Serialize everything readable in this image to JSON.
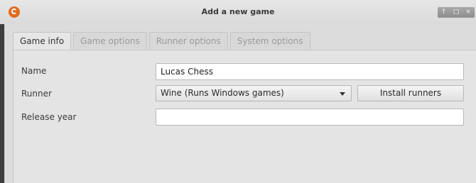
{
  "window": {
    "title": "Add a new game",
    "controls": [
      "↑",
      "□",
      "×"
    ]
  },
  "tabs": [
    {
      "label": "Game info",
      "active": true
    },
    {
      "label": "Game options",
      "active": false
    },
    {
      "label": "Runner options",
      "active": false
    },
    {
      "label": "System options",
      "active": false
    }
  ],
  "form": {
    "name_label": "Name",
    "name_value": "Lucas Chess",
    "runner_label": "Runner",
    "runner_value": "Wine (Runs Windows games)",
    "install_runners_label": "Install runners",
    "release_year_label": "Release year",
    "release_year_value": ""
  },
  "colors": {
    "accent": "#e36b1e"
  },
  "icons": {
    "app": "lutris-icon",
    "dropdown": "chevron-down-icon"
  }
}
